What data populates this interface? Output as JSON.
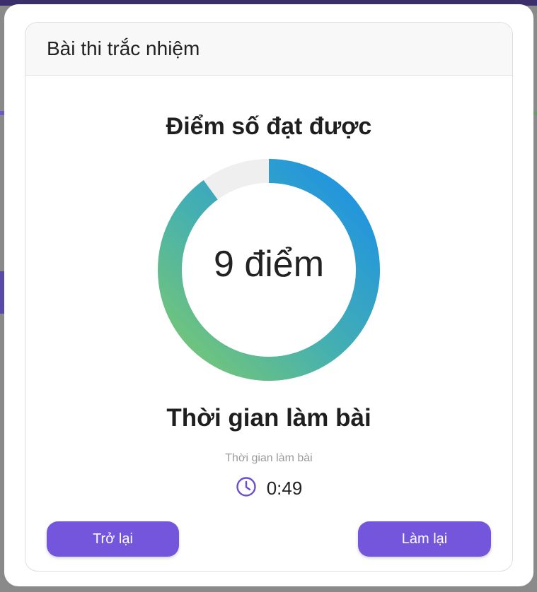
{
  "card": {
    "title": "Bài thi trắc nhiệm"
  },
  "score": {
    "heading": "Điểm số đạt được",
    "value_text": "9 điểm",
    "progress_fraction": 0.9,
    "gradient_start_color": "#7bc96f",
    "gradient_end_color": "#1a8fe8",
    "track_color": "#efefef"
  },
  "time": {
    "heading": "Thời gian làm bài",
    "caption": "Thời gian làm bài",
    "value": "0:49",
    "icon": "clock-icon",
    "icon_color": "#6c4fcf"
  },
  "buttons": {
    "back_label": "Trở lại",
    "retry_label": "Làm lại",
    "color": "#7356db"
  }
}
